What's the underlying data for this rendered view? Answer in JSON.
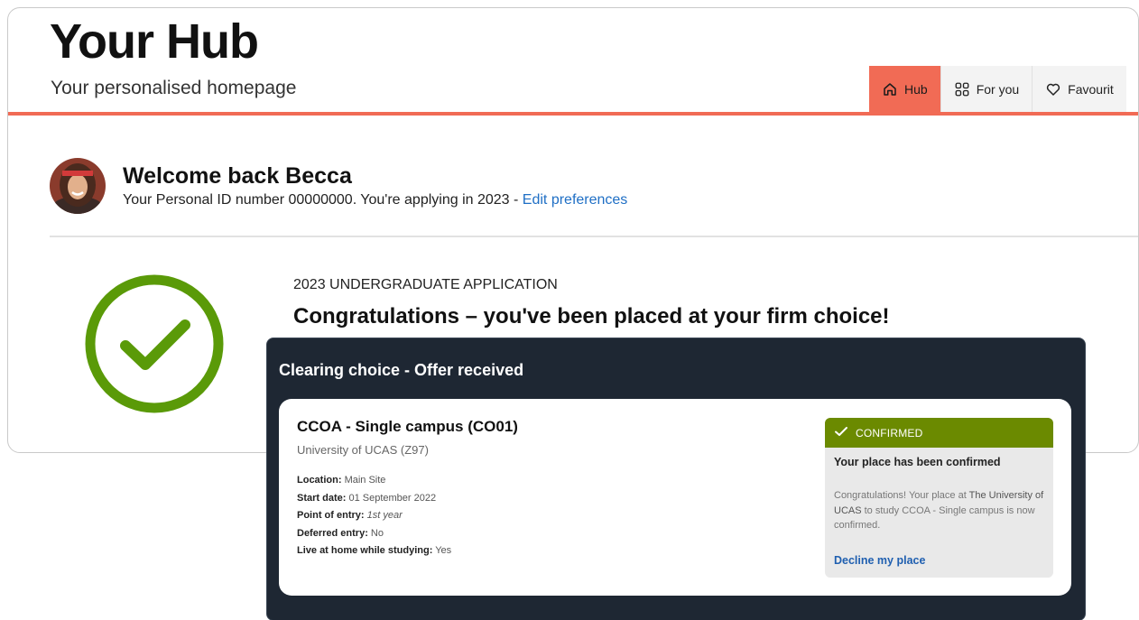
{
  "header": {
    "title": "Your Hub",
    "subtitle": "Your personalised homepage"
  },
  "tabs": [
    {
      "label": "Hub",
      "icon": "home-icon",
      "active": true
    },
    {
      "label": "For you",
      "icon": "grid-icon",
      "active": false
    },
    {
      "label": "Favourit",
      "icon": "heart-icon",
      "active": false
    }
  ],
  "welcome": {
    "title": "Welcome back Becca",
    "id_text": "Your Personal ID number 00000000.",
    "applying_text": "You're applying in 2023 -",
    "edit_link": "Edit preferences"
  },
  "application": {
    "heading": "2023 UNDERGRADUATE APPLICATION",
    "title": "Congratulations – you've been placed at your firm choice!"
  },
  "clearing": {
    "title": "Clearing choice - Offer received",
    "course": "CCOA - Single campus (CO01)",
    "provider": "University of UCAS (Z97)",
    "details": [
      {
        "label": "Location:",
        "value": "Main Site"
      },
      {
        "label": "Start date:",
        "value": "01 September 2022"
      },
      {
        "label": "Point of entry:",
        "value": "1st year"
      },
      {
        "label": "Deferred entry:",
        "value": "No"
      },
      {
        "label": "Live at home while studying:",
        "value": "Yes"
      }
    ],
    "status": {
      "badge": "CONFIRMED",
      "title": "Your place has been confirmed",
      "text_1": "Congratulations! Your place at",
      "text_university": "The University of UCAS",
      "text_2": "to study CCOA - Single campus is now confirmed.",
      "decline": "Decline my place"
    }
  },
  "colors": {
    "accent": "#f16b55",
    "success": "#5a9a08",
    "confirmed": "#6b8a00",
    "panel": "#1e2733",
    "link": "#1f6fc5"
  }
}
